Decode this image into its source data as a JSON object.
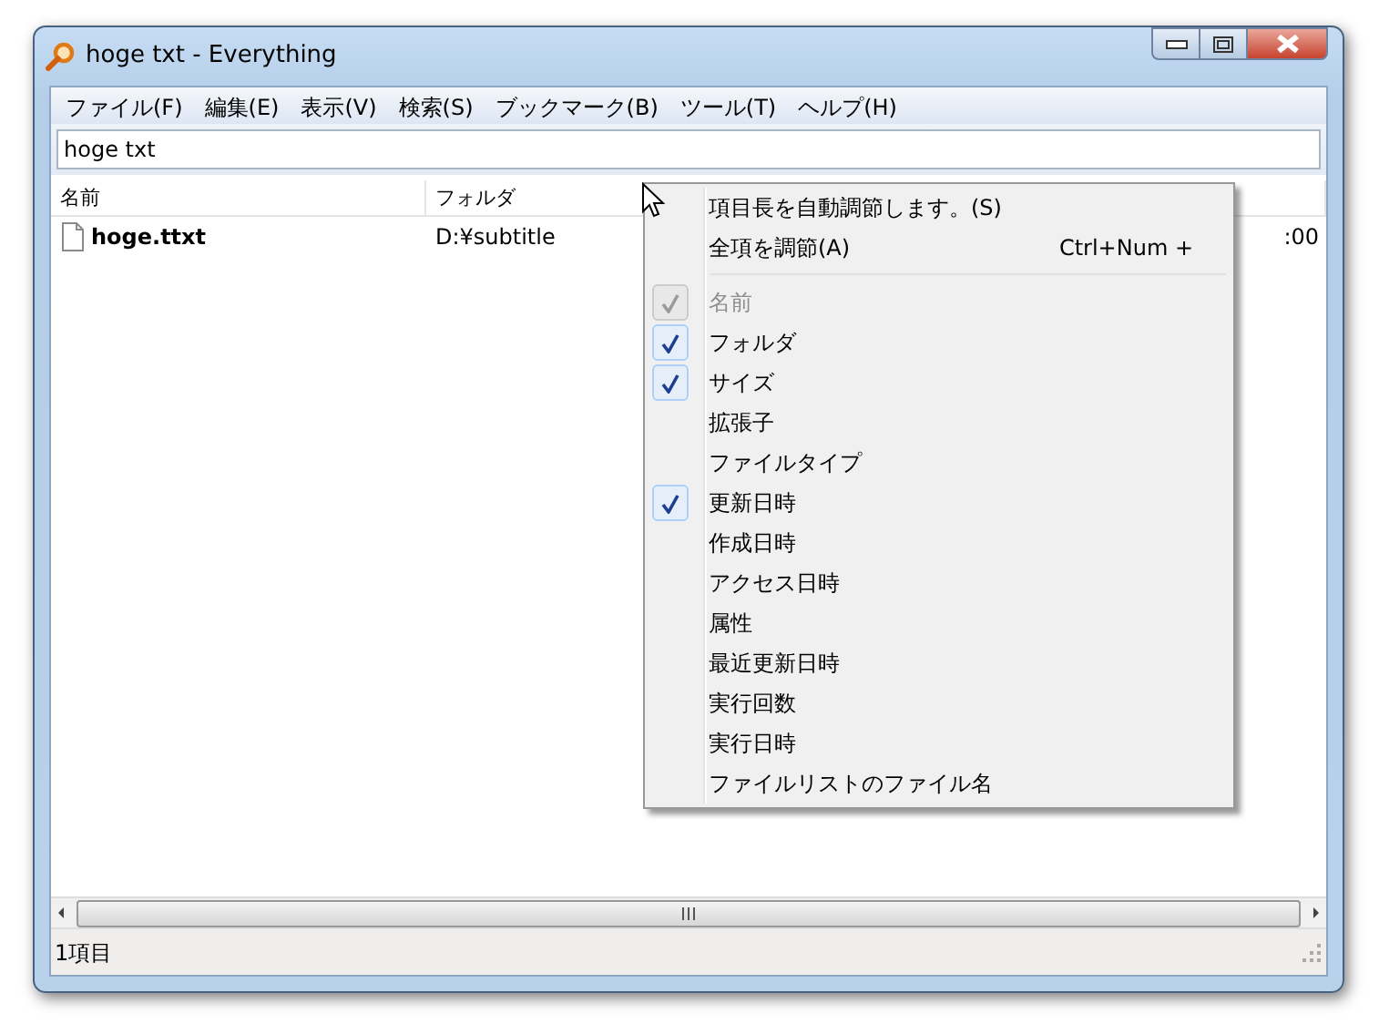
{
  "window": {
    "title": "hoge txt - Everything"
  },
  "menu_bar": [
    "ファイル(F)",
    "編集(E)",
    "表示(V)",
    "検索(S)",
    "ブックマーク(B)",
    "ツール(T)",
    "ヘルプ(H)"
  ],
  "search": {
    "value": "hoge txt"
  },
  "table": {
    "columns": [
      "名前",
      "フォルダ"
    ],
    "rows": [
      {
        "name": "hoge.ttxt",
        "folder": "D:¥subtitle",
        "column_3": ":00"
      }
    ]
  },
  "context_menu": {
    "items": [
      {
        "kind": "command",
        "label": "項目長を自動調節します。(S)"
      },
      {
        "kind": "command",
        "label": "全項を調節(A)",
        "shortcut": "Ctrl+Num +"
      },
      {
        "kind": "separator"
      },
      {
        "kind": "toggle",
        "label": "名前",
        "checked": true,
        "disabled": true
      },
      {
        "kind": "toggle",
        "label": "フォルダ",
        "checked": true,
        "disabled": false
      },
      {
        "kind": "toggle",
        "label": "サイズ",
        "checked": true,
        "disabled": false
      },
      {
        "kind": "toggle",
        "label": "拡張子",
        "checked": false,
        "disabled": false
      },
      {
        "kind": "toggle",
        "label": "ファイルタイプ",
        "checked": false,
        "disabled": false
      },
      {
        "kind": "toggle",
        "label": "更新日時",
        "checked": true,
        "disabled": false
      },
      {
        "kind": "toggle",
        "label": "作成日時",
        "checked": false,
        "disabled": false
      },
      {
        "kind": "toggle",
        "label": "アクセス日時",
        "checked": false,
        "disabled": false
      },
      {
        "kind": "toggle",
        "label": "属性",
        "checked": false,
        "disabled": false
      },
      {
        "kind": "toggle",
        "label": "最近更新日時",
        "checked": false,
        "disabled": false
      },
      {
        "kind": "toggle",
        "label": "実行回数",
        "checked": false,
        "disabled": false
      },
      {
        "kind": "toggle",
        "label": "実行日時",
        "checked": false,
        "disabled": false
      },
      {
        "kind": "toggle",
        "label": "ファイルリストのファイル名",
        "checked": false,
        "disabled": false
      }
    ]
  },
  "status_bar": "1項目"
}
